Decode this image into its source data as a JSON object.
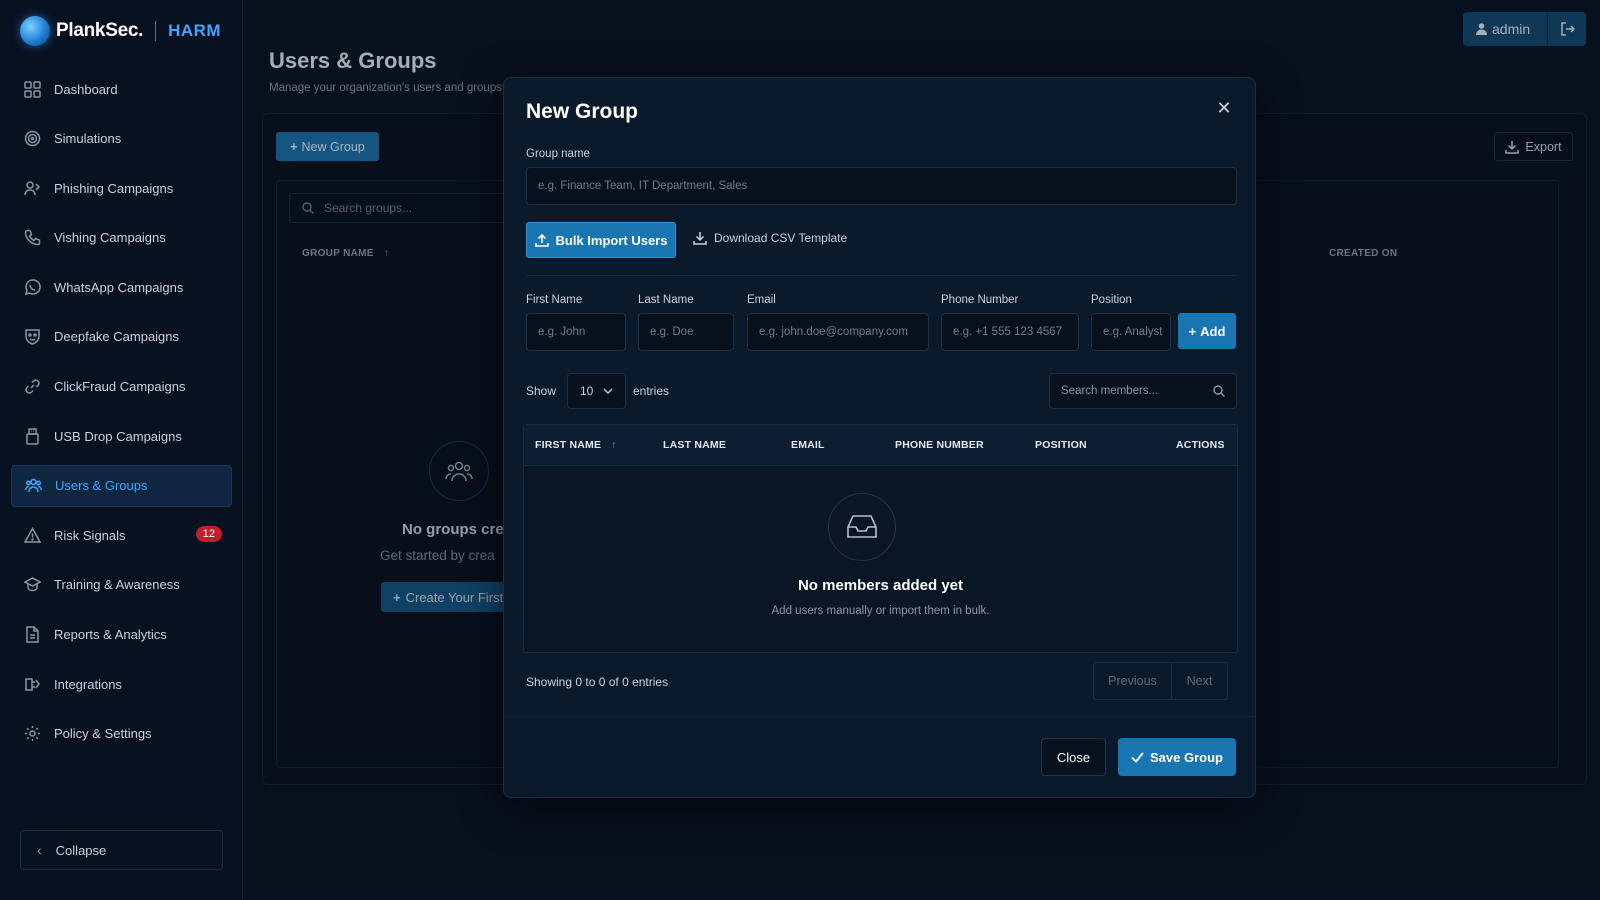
{
  "brand": {
    "name": "PlankSec.",
    "product": "HARM"
  },
  "sidebar": {
    "items": [
      {
        "label": "Dashboard",
        "icon": "dashboard-icon"
      },
      {
        "label": "Simulations",
        "icon": "target-icon"
      },
      {
        "label": "Phishing Campaigns",
        "icon": "phishing-icon"
      },
      {
        "label": "Vishing Campaigns",
        "icon": "phone-icon"
      },
      {
        "label": "WhatsApp Campaigns",
        "icon": "whatsapp-icon"
      },
      {
        "label": "Deepfake Campaigns",
        "icon": "deepfake-icon"
      },
      {
        "label": "ClickFraud Campaigns",
        "icon": "link-icon"
      },
      {
        "label": "USB Drop Campaigns",
        "icon": "usb-icon"
      },
      {
        "label": "Users & Groups",
        "icon": "users-icon",
        "active": true
      },
      {
        "label": "Risk Signals",
        "icon": "warning-icon",
        "badge": "12"
      },
      {
        "label": "Training & Awareness",
        "icon": "graduation-cap-icon"
      },
      {
        "label": "Reports & Analytics",
        "icon": "report-icon"
      },
      {
        "label": "Integrations",
        "icon": "integrations-icon"
      },
      {
        "label": "Policy & Settings",
        "icon": "gear-icon"
      }
    ],
    "collapse_label": "Collapse"
  },
  "header": {
    "user_label": "admin"
  },
  "page": {
    "title": "Users & Groups",
    "subtitle": "Manage your organization's users and groups",
    "new_group_label": "New Group",
    "export_label": "Export",
    "search_placeholder": "Search groups...",
    "col_group_name": "GROUP NAME",
    "col_created_on": "CREATED ON",
    "empty_title": "No groups cre",
    "empty_sub": "Get started by crea",
    "create_first_label": "Create Your First"
  },
  "modal": {
    "title": "New Group",
    "group_name_label": "Group name",
    "group_name_placeholder": "e.g. Finance Team, IT Department, Sales",
    "bulk_import_label": "Bulk Import Users",
    "download_csv_label": "Download CSV Template",
    "fields": {
      "first_name": {
        "label": "First Name",
        "placeholder": "e.g. John"
      },
      "last_name": {
        "label": "Last Name",
        "placeholder": "e.g. Doe"
      },
      "email": {
        "label": "Email",
        "placeholder": "e.g. john.doe@company.com"
      },
      "phone": {
        "label": "Phone Number",
        "placeholder": "e.g. +1 555 123 4567"
      },
      "position": {
        "label": "Position",
        "placeholder": "e.g. Analyst"
      }
    },
    "add_label": "Add",
    "show_label": "Show",
    "page_size": "10",
    "entries_label": "entries",
    "search_members_placeholder": "Search members...",
    "columns": [
      "FIRST NAME",
      "LAST NAME",
      "EMAIL",
      "PHONE NUMBER",
      "POSITION",
      "ACTIONS"
    ],
    "empty_title": "No members added yet",
    "empty_sub": "Add users manually or import them in bulk.",
    "showing_text": "Showing 0 to 0 of 0 entries",
    "prev_label": "Previous",
    "next_label": "Next",
    "close_label": "Close",
    "save_label": "Save Group"
  },
  "colors": {
    "accent": "#1a76b3",
    "brand_blue": "#3ea6ff",
    "badge_red": "#c01f2a",
    "background": "#081322"
  }
}
